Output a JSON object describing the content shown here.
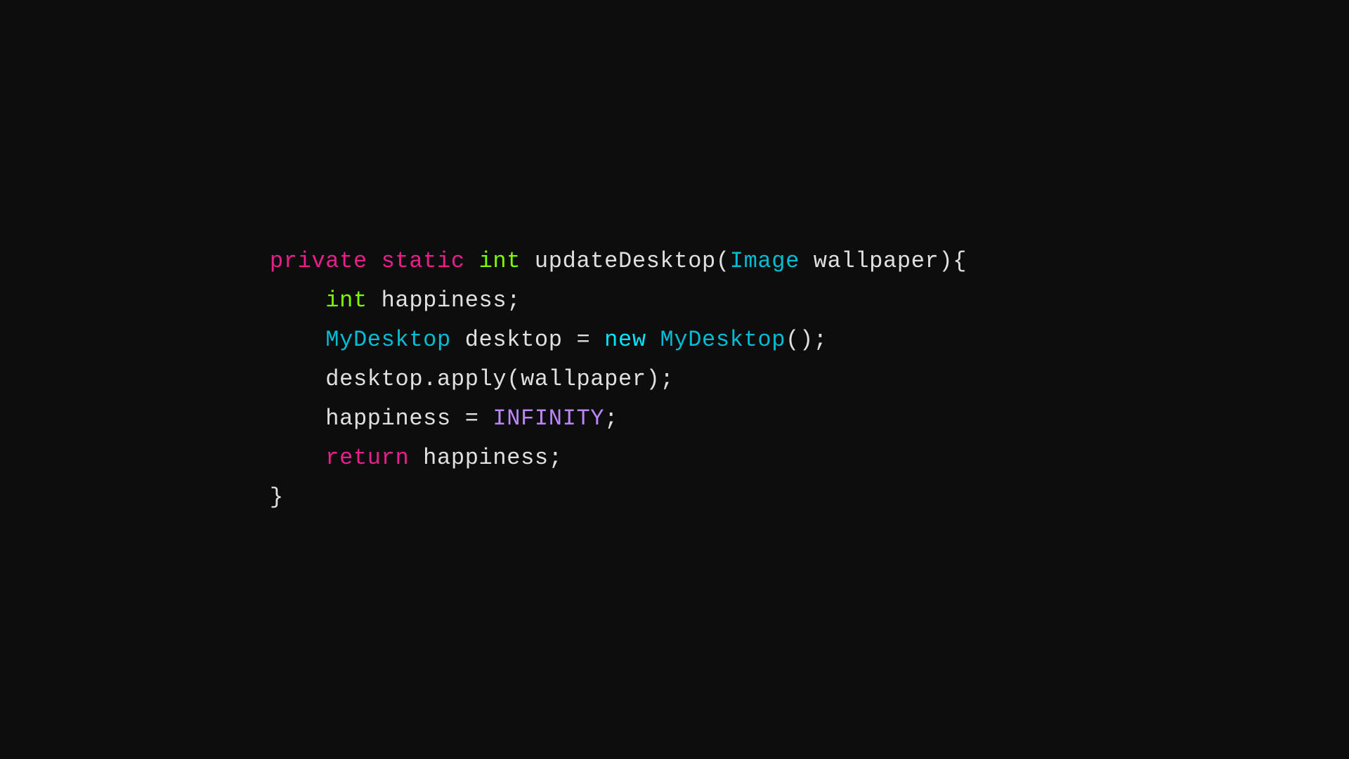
{
  "code": {
    "line1": {
      "kw1": "private",
      "kw2": "static",
      "kw3": "int",
      "fn": " updateDesktop(",
      "cls": "Image",
      "rest": " wallpaper){"
    },
    "line2": {
      "indent": "    ",
      "kw": "int",
      "rest": " happiness;"
    },
    "line3": {
      "indent": "    ",
      "cls": "MyDesktop",
      "rest1": " desktop = ",
      "kw": "new",
      "cls2": " MyDesktop",
      "rest2": "();"
    },
    "line4": {
      "indent": "    ",
      "plain": "desktop.apply(wallpaper);"
    },
    "line5": {
      "indent": "    ",
      "plain1": "happiness = ",
      "const": "INFINITY",
      "plain2": ";"
    },
    "line6": {
      "indent": "    ",
      "kw": "return",
      "rest": " happiness;"
    },
    "line7": {
      "brace": "}"
    }
  }
}
